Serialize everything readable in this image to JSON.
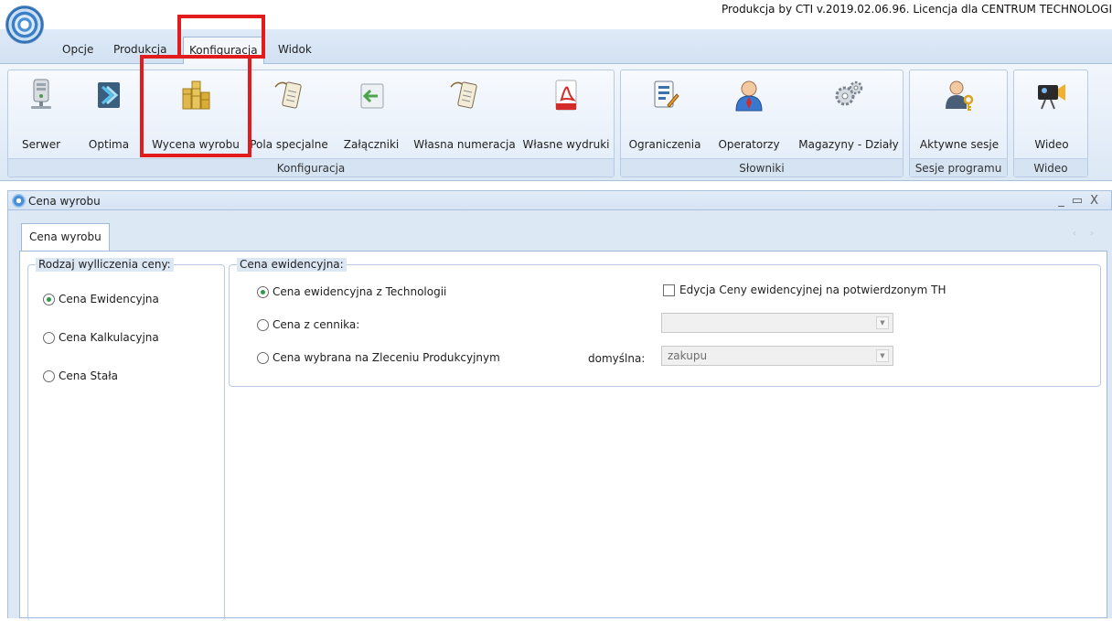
{
  "app": {
    "title": "Produkcja by CTI v.2019.02.06.96. Licencja dla CENTRUM TECHNOLOGI"
  },
  "menu": {
    "tabs": [
      "Opcje",
      "Produkcja",
      "Konfiguracja",
      "Widok"
    ],
    "active": "Konfiguracja"
  },
  "ribbon": {
    "groups": [
      {
        "label": "Konfiguracja",
        "buttons": [
          {
            "label": "Serwer",
            "icon": "server-icon"
          },
          {
            "label": "Optima",
            "icon": "optima-icon"
          },
          {
            "label": "Wycena wyrobu",
            "icon": "coins-icon"
          },
          {
            "label": "Pola specjalne",
            "icon": "tag-document-icon"
          },
          {
            "label": "Załączniki",
            "icon": "attachment-arrow-icon"
          },
          {
            "label": "Własna numeracja",
            "icon": "tag-document-icon"
          },
          {
            "label": "Własne wydruki",
            "icon": "pdf-icon"
          }
        ]
      },
      {
        "label": "Słowniki",
        "buttons": [
          {
            "label": "Ograniczenia",
            "icon": "restrictions-document-icon"
          },
          {
            "label": "Operatorzy",
            "icon": "operator-user-icon"
          },
          {
            "label": "Magazyny - Działy",
            "icon": "gears-icon"
          }
        ]
      },
      {
        "label": "Sesje programu",
        "buttons": [
          {
            "label": "Aktywne sesje",
            "icon": "user-key-icon"
          }
        ]
      },
      {
        "label": "Wideo",
        "buttons": [
          {
            "label": "Wideo",
            "icon": "video-camera-icon"
          }
        ]
      }
    ]
  },
  "window": {
    "title": "Cena wyrobu",
    "controls": [
      "_",
      "▭",
      "X"
    ],
    "tab": "Cena wyrobu",
    "tab_arrows": "‹ ›"
  },
  "rodzaj": {
    "legend": "Rodzaj wylliczenia ceny:",
    "options": [
      {
        "label": "Cena Ewidencyjna",
        "checked": true
      },
      {
        "label": "Cena Kalkulacyjna",
        "checked": false
      },
      {
        "label": "Cena Stała",
        "checked": false
      }
    ]
  },
  "ewidencyjna": {
    "legend": "Cena ewidencyjna:",
    "options": [
      {
        "label": "Cena ewidencyjna z Technologii",
        "checked": true
      },
      {
        "label": "Cena z cennika:",
        "checked": false
      },
      {
        "label": "Cena wybrana na Zleceniu Produkcyjnym",
        "checked": false
      }
    ],
    "checkbox_label": "Edycja Ceny ewidencyjnej na potwierdzonym TH",
    "checkbox_checked": false,
    "cennik_value": "",
    "domyslna_label": "domyślna:",
    "domyslna_value": "zakupu"
  },
  "colors": {
    "highlight": "#e21c1c",
    "ribbon_bg": "#dce8f6",
    "radio_checked": "#2e9a4b"
  }
}
